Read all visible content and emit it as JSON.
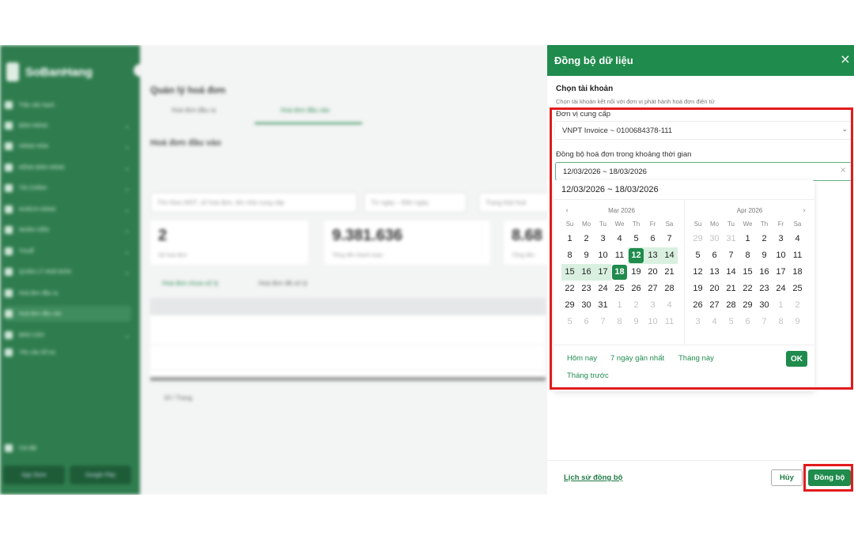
{
  "background_app": {
    "brand": "SoBanHang",
    "sidebar": [
      {
        "label": "Trần văn hạnh",
        "chev": ""
      },
      {
        "label": "BÁN HÀNG",
        "chev": "⌄"
      },
      {
        "label": "HÀNG HÓA",
        "chev": "⌄"
      },
      {
        "label": "KÊNH BÁN HÀNG",
        "chev": "⌄"
      },
      {
        "label": "TÀI CHÍNH",
        "chev": "⌄"
      },
      {
        "label": "KHÁCH HÀNG",
        "chev": "⌄"
      },
      {
        "label": "NHÂN VIÊN",
        "chev": "⌄"
      },
      {
        "label": "THUẾ",
        "chev": "⌄"
      },
      {
        "label": "QUẢN LÝ HOÁ ĐƠN",
        "chev": "⌄"
      },
      {
        "label": "Hoá đơn đầu ra",
        "chev": ""
      },
      {
        "label": "Hoá đơn đầu vào",
        "chev": ""
      },
      {
        "label": "BÁO CÁO",
        "chev": "⌄"
      },
      {
        "label": "Yêu cầu hỗ trợ",
        "chev": ""
      }
    ],
    "sidebar_bottom": "Cài đặt",
    "store_app": "App Store",
    "store_play": "Google Play",
    "page_title": "Quản lý hoá đơn",
    "tab_out": "Hoá đơn đầu ra",
    "tab_in": "Hoá đơn đầu vào",
    "section": "Hoá đơn đầu vào",
    "search_placeholder": "Tìm theo MST, số hoá đơn, tên nhà cung cấp",
    "date_filter": "Từ ngày – Đến ngày",
    "status_filter": "Trạng thái hoá",
    "card1_value": "2",
    "card1_label": "Số hoá đơn",
    "card2_value": "9.381.636",
    "card2_label": "Tổng tiền thanh toán",
    "card3_value": "8.68",
    "card3_label": "Tổng tiền",
    "subtab1": "Hoá đơn chưa xử lý",
    "subtab2": "Hoá đơn đã xử lý",
    "pager": "10 / Trang"
  },
  "dialog": {
    "title": "Đồng bộ dữ liệu",
    "close_icon": "×",
    "section_title": "Chọn tài khoản",
    "section_desc": "Chọn tài khoản kết nối với đơn vị phát hành hoá đơn điện tử",
    "provider_label": "Đơn vị cung cấp",
    "provider_value": "VNPT Invoice ~ 0100684378-111",
    "provider_chev": "⌄",
    "range_label": "Đồng bộ hoá đơn trong khoảng thời gian",
    "range_value": "12/03/2026 ~ 18/03/2026",
    "clear_icon": "×",
    "history_link": "Lịch sử đồng bộ",
    "cancel_label": "Hủy",
    "sync_label": "Đồng bộ"
  },
  "datepicker": {
    "range_text": "12/03/2026 ~ 18/03/2026",
    "weekdays": [
      "Su",
      "Mo",
      "Tu",
      "We",
      "Th",
      "Fr",
      "Sa"
    ],
    "prev_icon": "‹",
    "next_icon": "›",
    "left_month": "Mar 2026",
    "right_month": "Apr 2026",
    "range_start": 12,
    "range_end": 18,
    "left_days": [
      [
        1,
        2,
        3,
        4,
        5,
        6,
        7
      ],
      [
        8,
        9,
        10,
        11,
        12,
        13,
        14
      ],
      [
        15,
        16,
        17,
        18,
        19,
        20,
        21
      ],
      [
        22,
        23,
        24,
        25,
        26,
        27,
        28
      ],
      [
        29,
        30,
        31,
        1,
        2,
        3,
        4
      ],
      [
        5,
        6,
        7,
        8,
        9,
        10,
        11
      ]
    ],
    "right_days": [
      [
        29,
        30,
        31,
        1,
        2,
        3,
        4
      ],
      [
        5,
        6,
        7,
        8,
        9,
        10,
        11
      ],
      [
        12,
        13,
        14,
        15,
        16,
        17,
        18
      ],
      [
        19,
        20,
        21,
        22,
        23,
        24,
        25
      ],
      [
        26,
        27,
        28,
        29,
        30,
        1,
        2
      ],
      [
        3,
        4,
        5,
        6,
        7,
        8,
        9
      ]
    ],
    "presets": [
      "Hôm nay",
      "7 ngày gần nhất",
      "Tháng này",
      "Tháng trước"
    ],
    "ok_label": "OK"
  },
  "colors": {
    "brand_green": "#1f8b4c",
    "range_fill": "#d9f0e0",
    "highlight_red": "#e21b1b",
    "sidebar_green": "#2f7d4f"
  }
}
